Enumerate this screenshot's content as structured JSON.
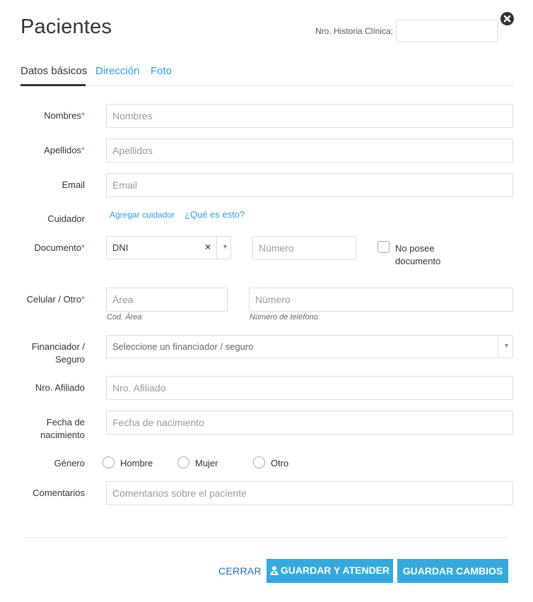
{
  "header": {
    "title": "Pacientes",
    "historia_label": "Nro. Historia Clínica:",
    "historia_value": ""
  },
  "tabs": [
    {
      "label": "Datos básicos",
      "active": true
    },
    {
      "label": "Dirección",
      "active": false
    },
    {
      "label": "Foto",
      "active": false
    }
  ],
  "form": {
    "nombres": {
      "label": "Nombres",
      "required": "*",
      "placeholder": "Nombres"
    },
    "apellidos": {
      "label": "Apellidos",
      "required": "*",
      "placeholder": "Apellidos"
    },
    "email": {
      "label": "Email",
      "placeholder": "Email"
    },
    "cuidador": {
      "label": "Cuidador",
      "add_link": "Agregar cuidador",
      "help_link": "¿Qué es esto?"
    },
    "documento": {
      "label": "Documento",
      "required": "*",
      "type_value": "DNI",
      "clear_symbol": "×",
      "number_placeholder": "Número",
      "no_doc_label_1": "No posee",
      "no_doc_label_2": "documento"
    },
    "celular": {
      "label": "Celular / Otro",
      "required": "*",
      "area_placeholder": "Área",
      "area_hint": "Cod. Área",
      "numero_placeholder": "Número",
      "numero_hint": "Número de teléfono"
    },
    "financiador": {
      "label_1": "Financiador /",
      "label_2": "Seguro",
      "placeholder": "Seleccione un financiador / seguro"
    },
    "afiliado": {
      "label": "Nro. Afiliado",
      "placeholder": "Nro. Afiliado"
    },
    "nacimiento": {
      "label_1": "Fecha de",
      "label_2": "nacimiento",
      "placeholder": "Fecha de nacimiento"
    },
    "genero": {
      "label": "Género",
      "options": [
        "Hombre",
        "Mujer",
        "Otro"
      ]
    },
    "comentarios": {
      "label": "Comentarios",
      "placeholder": "Comentarios sobre el paciente"
    }
  },
  "footer": {
    "cerrar": "CERRAR",
    "guardar_atender": "GUARDAR Y ATENDER",
    "guardar_cambios": "GUARDAR CAMBIOS"
  },
  "colors": {
    "accent": "#33a9df",
    "link": "#2a9fd6",
    "required": "#d9534f"
  }
}
